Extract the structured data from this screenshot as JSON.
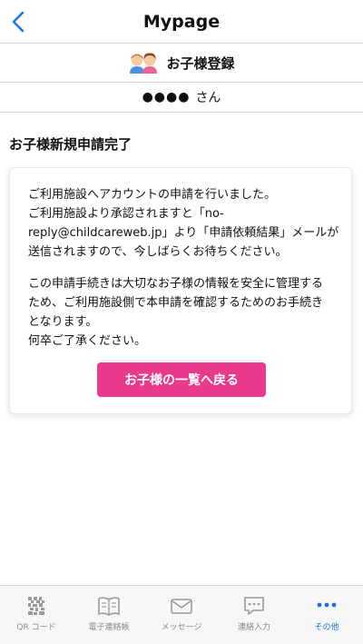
{
  "nav": {
    "title": "Mypage"
  },
  "section": {
    "title": "お子様登録"
  },
  "user": {
    "name": "●●●●",
    "suffix": "さん"
  },
  "heading": "お子様新規申請完了",
  "card": {
    "message1": "ご利用施設へアカウントの申請を行いました。\nご利用施設より承認されますと「no-\nreply@childcareweb.jp」より「申請依頼結果」メールが\n送信されますので、今しばらくお待ちください。",
    "message2": "この申請手続きは大切なお子様の情報を安全に管理する\nため、ご利用施設側で本申請を確認するためのお手続き\nとなります。\n何卒ご了承ください。",
    "button_label": "お子様の一覧へ戻る"
  },
  "tabs": [
    {
      "label": "QR コード",
      "icon": "qr-code-icon"
    },
    {
      "label": "電子連絡帳",
      "icon": "book-icon"
    },
    {
      "label": "メッセージ",
      "icon": "mail-icon"
    },
    {
      "label": "連絡入力",
      "icon": "chat-icon"
    },
    {
      "label": "その他",
      "icon": "more-icon",
      "active": true
    }
  ],
  "colors": {
    "accent": "#e8398a",
    "link_blue": "#1a73e8",
    "tab_inactive": "#8a8a8a"
  }
}
